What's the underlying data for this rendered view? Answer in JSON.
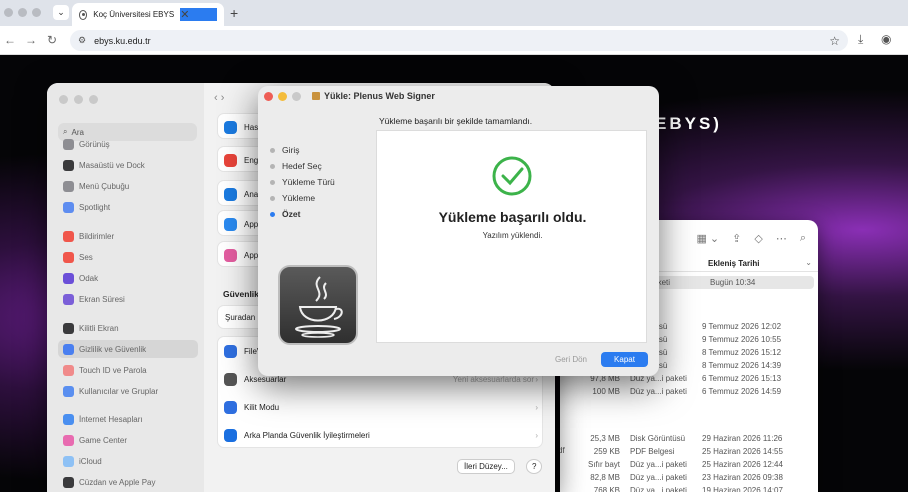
{
  "browser": {
    "tab_title": "Koç Üniversitesi EBYS",
    "url": "ebys.ku.edu.tr",
    "new_tab_glyph": "+",
    "tab_close_glyph": "✕"
  },
  "page": {
    "brand_fragment": "EBYS)"
  },
  "finder": {
    "column_header": "Ekleniş Tarihi",
    "rows": [
      {
        "size": "",
        "kind": "...i paketi",
        "date": "Bugün 10:34",
        "selected": true
      },
      {
        "size": "",
        "kind": "Görüntüsü",
        "date": "9 Temmuz 2026 12:02"
      },
      {
        "size": "",
        "kind": "Görüntüsü",
        "date": "9 Temmuz 2026 10:55"
      },
      {
        "size": "",
        "kind": "Görüntüsü",
        "date": "8 Temmuz 2026 15:12"
      },
      {
        "size": "",
        "kind": "Görüntüsü",
        "date": "8 Temmuz 2026 14:39"
      },
      {
        "size": "97,8 MB",
        "kind": "Düz ya...i paketi",
        "date": "6 Temmuz 2026 15:13"
      },
      {
        "size": "100 MB",
        "kind": "Düz ya...i paketi",
        "date": "6 Temmuz 2026 14:59"
      },
      {
        "size": "25,3 MB",
        "kind": "Disk Görüntüsü",
        "date": "29 Haziran 2026 11:26"
      },
      {
        "size": "259 KB",
        "kind": "PDF Belgesi",
        "date": "25 Haziran 2026 14:55"
      },
      {
        "size": "Sıfır bayt",
        "kind": "Düz ya...i paketi",
        "date": "25 Haziran 2026 12:44"
      },
      {
        "size": "82,8 MB",
        "kind": "Düz ya...i paketi",
        "date": "23 Haziran 2026 09:38"
      },
      {
        "size": "768 KB",
        "kind": "Düz ya...i paketi",
        "date": "19 Haziran 2026 14:07"
      }
    ],
    "partial_left": "df"
  },
  "settings": {
    "search_placeholder": "Ara",
    "sidebar": [
      {
        "label": "Görünüş",
        "color": "#8e8e93"
      },
      {
        "label": "Masaüstü ve Dock",
        "color": "#3a3a3c"
      },
      {
        "label": "Menü Çubuğu",
        "color": "#8e8e93"
      },
      {
        "label": "Spotlight",
        "color": "#5e8df0"
      },
      {
        "label": "Bildirimler",
        "color": "#f0564b"
      },
      {
        "label": "Ses",
        "color": "#f0564b"
      },
      {
        "label": "Odak",
        "color": "#6b4fd8"
      },
      {
        "label": "Ekran Süresi",
        "color": "#7b5fd8"
      },
      {
        "label": "Kilitli Ekran",
        "color": "#3a3a3c"
      },
      {
        "label": "Gizlilik ve Güvenlik",
        "color": "#4a7ff0",
        "active": true
      },
      {
        "label": "Touch ID ve Parola",
        "color": "#f08a8a"
      },
      {
        "label": "Kullanıcılar ve Gruplar",
        "color": "#5a8ff0"
      },
      {
        "label": "İnternet Hesapları",
        "color": "#4a8ff0"
      },
      {
        "label": "Game Center",
        "color": "#e86bb0"
      },
      {
        "label": "iCloud",
        "color": "#8ec1f5"
      },
      {
        "label": "Cüzdan ve Apple Pay",
        "color": "#3a3a3c"
      }
    ],
    "main_rows_top": [
      {
        "label": "Has",
        "color": "#1a7ae0"
      },
      {
        "label": "Eng",
        "color": "#e8443a"
      },
      {
        "label": "Ana",
        "color": "#1a7ae0"
      },
      {
        "label": "App",
        "color": "#2a8af0"
      },
      {
        "label": "App",
        "color": "#e35da0"
      }
    ],
    "security_title": "Güvenlik",
    "allow_from": "Şuradan",
    "rows_bottom": [
      {
        "label": "FileV",
        "color": "#2f6fe0",
        "right": ""
      },
      {
        "label": "Aksesuarlar",
        "color": "#555555",
        "right": "Yeni aksesuarlarda sor"
      },
      {
        "label": "Kilit Modu",
        "color": "#2f6fe0",
        "right": ""
      },
      {
        "label": "Arka Planda Güvenlik İyileştirmeleri",
        "color": "#1a6fe0",
        "right": ""
      }
    ],
    "advanced_button": "İleri Düzey...",
    "help_button": "?"
  },
  "dialog": {
    "title": "Yükle: Plenus Web Signer",
    "message": "Yükleme başarılı bir şekilde tamamlandı.",
    "steps": [
      {
        "label": "Giriş",
        "current": false
      },
      {
        "label": "Hedef Seç",
        "current": false
      },
      {
        "label": "Yükleme Türü",
        "current": false
      },
      {
        "label": "Yükleme",
        "current": false
      },
      {
        "label": "Özet",
        "current": true
      }
    ],
    "success_title": "Yükleme başarılı oldu.",
    "success_sub": "Yazılım yüklendi.",
    "back_button": "Geri Dön",
    "close_button": "Kapat",
    "accent_color": "#2b7cf0",
    "check_color": "#3cb34a"
  }
}
